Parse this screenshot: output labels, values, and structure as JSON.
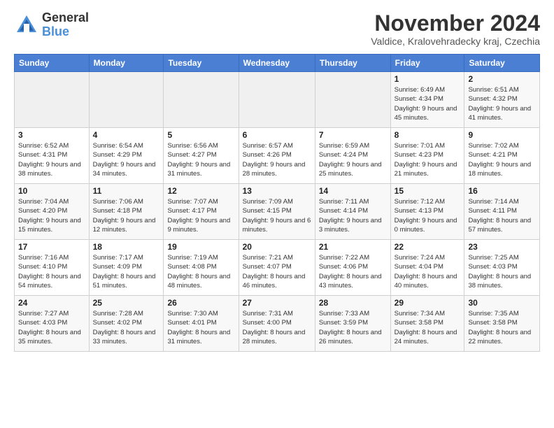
{
  "header": {
    "logo_line1": "General",
    "logo_line2": "Blue",
    "month_title": "November 2024",
    "location": "Valdice, Kralovehradecky kraj, Czechia"
  },
  "weekdays": [
    "Sunday",
    "Monday",
    "Tuesday",
    "Wednesday",
    "Thursday",
    "Friday",
    "Saturday"
  ],
  "weeks": [
    [
      {
        "day": "",
        "info": ""
      },
      {
        "day": "",
        "info": ""
      },
      {
        "day": "",
        "info": ""
      },
      {
        "day": "",
        "info": ""
      },
      {
        "day": "",
        "info": ""
      },
      {
        "day": "1",
        "info": "Sunrise: 6:49 AM\nSunset: 4:34 PM\nDaylight: 9 hours and 45 minutes."
      },
      {
        "day": "2",
        "info": "Sunrise: 6:51 AM\nSunset: 4:32 PM\nDaylight: 9 hours and 41 minutes."
      }
    ],
    [
      {
        "day": "3",
        "info": "Sunrise: 6:52 AM\nSunset: 4:31 PM\nDaylight: 9 hours and 38 minutes."
      },
      {
        "day": "4",
        "info": "Sunrise: 6:54 AM\nSunset: 4:29 PM\nDaylight: 9 hours and 34 minutes."
      },
      {
        "day": "5",
        "info": "Sunrise: 6:56 AM\nSunset: 4:27 PM\nDaylight: 9 hours and 31 minutes."
      },
      {
        "day": "6",
        "info": "Sunrise: 6:57 AM\nSunset: 4:26 PM\nDaylight: 9 hours and 28 minutes."
      },
      {
        "day": "7",
        "info": "Sunrise: 6:59 AM\nSunset: 4:24 PM\nDaylight: 9 hours and 25 minutes."
      },
      {
        "day": "8",
        "info": "Sunrise: 7:01 AM\nSunset: 4:23 PM\nDaylight: 9 hours and 21 minutes."
      },
      {
        "day": "9",
        "info": "Sunrise: 7:02 AM\nSunset: 4:21 PM\nDaylight: 9 hours and 18 minutes."
      }
    ],
    [
      {
        "day": "10",
        "info": "Sunrise: 7:04 AM\nSunset: 4:20 PM\nDaylight: 9 hours and 15 minutes."
      },
      {
        "day": "11",
        "info": "Sunrise: 7:06 AM\nSunset: 4:18 PM\nDaylight: 9 hours and 12 minutes."
      },
      {
        "day": "12",
        "info": "Sunrise: 7:07 AM\nSunset: 4:17 PM\nDaylight: 9 hours and 9 minutes."
      },
      {
        "day": "13",
        "info": "Sunrise: 7:09 AM\nSunset: 4:15 PM\nDaylight: 9 hours and 6 minutes."
      },
      {
        "day": "14",
        "info": "Sunrise: 7:11 AM\nSunset: 4:14 PM\nDaylight: 9 hours and 3 minutes."
      },
      {
        "day": "15",
        "info": "Sunrise: 7:12 AM\nSunset: 4:13 PM\nDaylight: 9 hours and 0 minutes."
      },
      {
        "day": "16",
        "info": "Sunrise: 7:14 AM\nSunset: 4:11 PM\nDaylight: 8 hours and 57 minutes."
      }
    ],
    [
      {
        "day": "17",
        "info": "Sunrise: 7:16 AM\nSunset: 4:10 PM\nDaylight: 8 hours and 54 minutes."
      },
      {
        "day": "18",
        "info": "Sunrise: 7:17 AM\nSunset: 4:09 PM\nDaylight: 8 hours and 51 minutes."
      },
      {
        "day": "19",
        "info": "Sunrise: 7:19 AM\nSunset: 4:08 PM\nDaylight: 8 hours and 48 minutes."
      },
      {
        "day": "20",
        "info": "Sunrise: 7:21 AM\nSunset: 4:07 PM\nDaylight: 8 hours and 46 minutes."
      },
      {
        "day": "21",
        "info": "Sunrise: 7:22 AM\nSunset: 4:06 PM\nDaylight: 8 hours and 43 minutes."
      },
      {
        "day": "22",
        "info": "Sunrise: 7:24 AM\nSunset: 4:04 PM\nDaylight: 8 hours and 40 minutes."
      },
      {
        "day": "23",
        "info": "Sunrise: 7:25 AM\nSunset: 4:03 PM\nDaylight: 8 hours and 38 minutes."
      }
    ],
    [
      {
        "day": "24",
        "info": "Sunrise: 7:27 AM\nSunset: 4:03 PM\nDaylight: 8 hours and 35 minutes."
      },
      {
        "day": "25",
        "info": "Sunrise: 7:28 AM\nSunset: 4:02 PM\nDaylight: 8 hours and 33 minutes."
      },
      {
        "day": "26",
        "info": "Sunrise: 7:30 AM\nSunset: 4:01 PM\nDaylight: 8 hours and 31 minutes."
      },
      {
        "day": "27",
        "info": "Sunrise: 7:31 AM\nSunset: 4:00 PM\nDaylight: 8 hours and 28 minutes."
      },
      {
        "day": "28",
        "info": "Sunrise: 7:33 AM\nSunset: 3:59 PM\nDaylight: 8 hours and 26 minutes."
      },
      {
        "day": "29",
        "info": "Sunrise: 7:34 AM\nSunset: 3:58 PM\nDaylight: 8 hours and 24 minutes."
      },
      {
        "day": "30",
        "info": "Sunrise: 7:35 AM\nSunset: 3:58 PM\nDaylight: 8 hours and 22 minutes."
      }
    ]
  ]
}
